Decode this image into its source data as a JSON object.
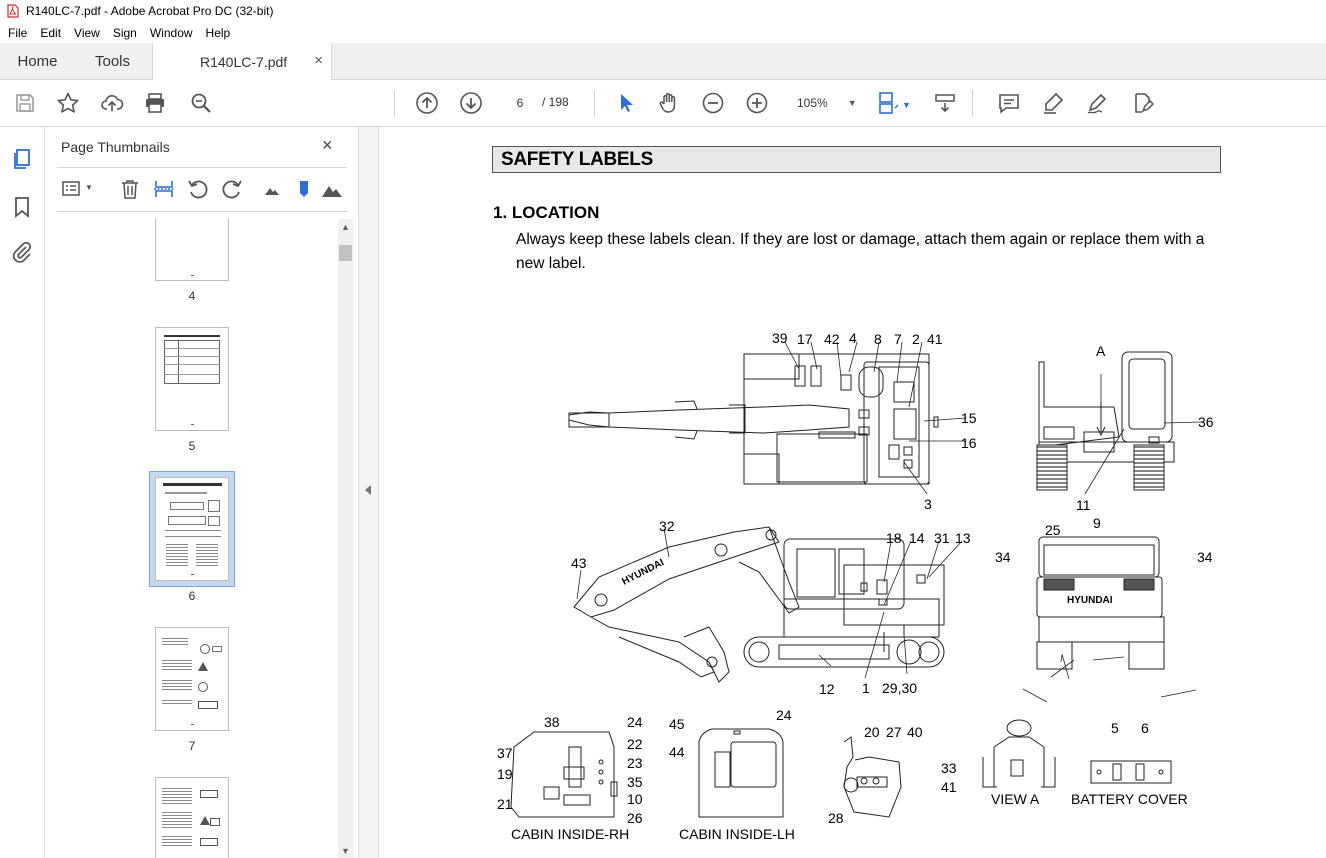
{
  "window": {
    "title": "R140LC-7.pdf - Adobe Acrobat Pro DC (32-bit)"
  },
  "menu": [
    "File",
    "Edit",
    "View",
    "Sign",
    "Window",
    "Help"
  ],
  "tabs": {
    "home": "Home",
    "tools": "Tools",
    "document": "R140LC-7.pdf",
    "close": "×"
  },
  "toolbar": {
    "current_page": "6",
    "page_total": "/ 198",
    "zoom": "105%"
  },
  "thumbnails_panel": {
    "title": "Page Thumbnails",
    "close": "×",
    "pages": [
      {
        "num": "4"
      },
      {
        "num": "5"
      },
      {
        "num": "6",
        "selected": true
      },
      {
        "num": "7"
      },
      {
        "num": ""
      }
    ]
  },
  "document": {
    "section_header": "SAFETY LABELS",
    "location_title": "1.  LOCATION",
    "location_body": "Always keep these labels clean.  If they are lost or damage, attach them again or replace them with a new label.",
    "callouts": {
      "top_view": [
        "39",
        "17",
        "42",
        "4",
        "8",
        "7",
        "2",
        "41",
        "15",
        "16",
        "3"
      ],
      "rear_view": [
        "A",
        "36",
        "11"
      ],
      "side_view": [
        "32",
        "43",
        "18",
        "14",
        "31",
        "13",
        "12",
        "1",
        "29,30"
      ],
      "back_view": [
        "25",
        "9",
        "34",
        "34"
      ],
      "brand": "HYUNDAI",
      "cabin_rh": [
        "38",
        "24",
        "22",
        "23",
        "35",
        "10",
        "26",
        "37",
        "19",
        "21"
      ],
      "cabin_lh": [
        "45",
        "24",
        "44"
      ],
      "joystick": [
        "20",
        "27",
        "40",
        "28"
      ],
      "view_a": [
        "33",
        "41"
      ],
      "battery": [
        "5",
        "6"
      ]
    },
    "captions": {
      "cabin_rh": "CABIN INSIDE-RH",
      "cabin_lh": "CABIN INSIDE-LH",
      "view_a": "VIEW A",
      "battery": "BATTERY COVER"
    }
  }
}
